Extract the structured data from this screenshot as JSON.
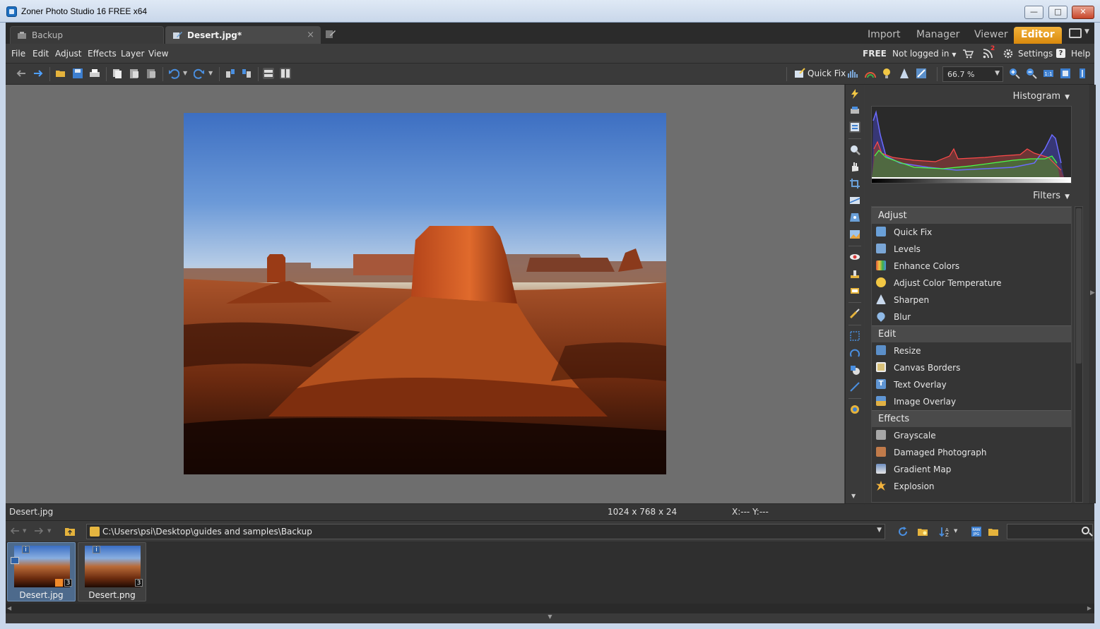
{
  "window": {
    "title": "Zoner Photo Studio 16 FREE x64",
    "controls": [
      "minimize",
      "maximize",
      "close"
    ]
  },
  "tabs": {
    "items": [
      {
        "label": "Backup",
        "active": false
      },
      {
        "label": "Desert.jpg*",
        "active": true
      }
    ],
    "modes": [
      {
        "label": "Import",
        "active": false
      },
      {
        "label": "Manager",
        "active": false
      },
      {
        "label": "Viewer",
        "active": false
      },
      {
        "label": "Editor",
        "active": true
      }
    ]
  },
  "menu": {
    "items": [
      "File",
      "Edit",
      "Adjust",
      "Effects",
      "Layer",
      "View"
    ],
    "right": {
      "edition": "FREE",
      "login": "Not logged in",
      "news_badge": "2",
      "settings": "Settings",
      "help": "Help"
    }
  },
  "toolbar": {
    "quick_fix_label": "Quick Fix",
    "zoom_value": "66.7 %"
  },
  "panel": {
    "histogram_title": "Histogram",
    "filters_title": "Filters",
    "sections": [
      {
        "name": "Adjust",
        "items": [
          {
            "label": "Quick Fix",
            "icon": "quick-fix-icon",
            "color": "#6aa0d8"
          },
          {
            "label": "Levels",
            "icon": "levels-icon",
            "color": "#7aa6d6"
          },
          {
            "label": "Enhance Colors",
            "icon": "rainbow-icon",
            "color": "#e05a3a"
          },
          {
            "label": "Adjust Color Temperature",
            "icon": "bulb-icon",
            "color": "#f2c744"
          },
          {
            "label": "Sharpen",
            "icon": "sharpen-icon",
            "color": "#c8d8ec"
          },
          {
            "label": "Blur",
            "icon": "drop-icon",
            "color": "#8fb9e6"
          }
        ]
      },
      {
        "name": "Edit",
        "items": [
          {
            "label": "Resize",
            "icon": "resize-icon",
            "color": "#5b8fc9"
          },
          {
            "label": "Canvas  Borders",
            "icon": "canvas-borders-icon",
            "color": "#d9c27a"
          },
          {
            "label": "Text Overlay",
            "icon": "text-overlay-icon",
            "color": "#5f95d3"
          },
          {
            "label": "Image Overlay",
            "icon": "image-overlay-icon",
            "color": "#e0b044"
          }
        ]
      },
      {
        "name": "Effects",
        "items": [
          {
            "label": "Grayscale",
            "icon": "grayscale-icon",
            "color": "#a7a7a7"
          },
          {
            "label": "Damaged Photograph",
            "icon": "damaged-photo-icon",
            "color": "#c07a4a"
          },
          {
            "label": "Gradient Map",
            "icon": "gradient-map-icon",
            "color": "#6e8fc0"
          },
          {
            "label": "Explosion",
            "icon": "explosion-icon",
            "color": "#f3b33d"
          }
        ]
      }
    ]
  },
  "status": {
    "filename": "Desert.jpg",
    "dimensions": "1024 x 768 x 24",
    "coordinates": "X:---  Y:---"
  },
  "browser": {
    "path": "C:\\Users\\psi\\Desktop\\guides and samples\\Backup"
  },
  "filmstrip": {
    "items": [
      {
        "label": "Desert.jpg",
        "selected": true,
        "count": "3"
      },
      {
        "label": "Desert.png",
        "selected": false,
        "count": "3"
      }
    ]
  },
  "colors": {
    "accent": "#e8a020",
    "background": "#3c3c3c",
    "canvas": "#6e6e6e"
  }
}
